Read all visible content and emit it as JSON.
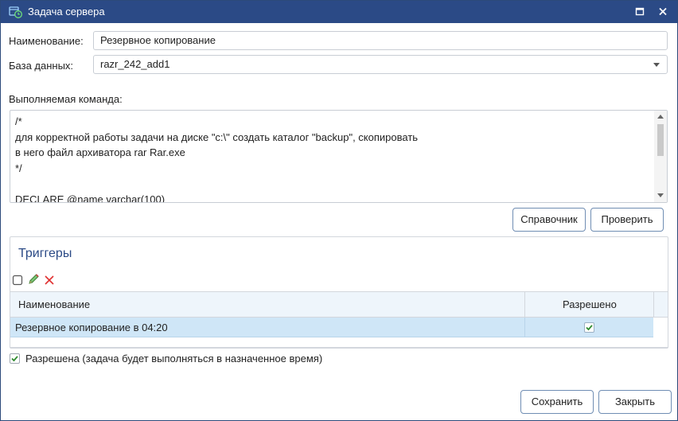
{
  "window": {
    "title": "Задача сервера"
  },
  "form": {
    "name_label": "Наименование:",
    "name_value": "Резервное копирование",
    "database_label": "База данных:",
    "database_value": "razr_242_add1",
    "command_label": "Выполняемая команда:",
    "command_text": "/*\nдля корректной работы задачи на диске \"c:\\\" создать каталог \"backup\", скопировать\nв него файл архиватора rar Rar.exe\n*/\n\nDECLARE @name varchar(100)"
  },
  "buttons": {
    "reference": "Справочник",
    "check": "Проверить",
    "save": "Сохранить",
    "close": "Закрыть"
  },
  "triggers": {
    "title": "Триггеры",
    "columns": [
      "Наименование",
      "Разрешено"
    ],
    "rows": [
      {
        "name": "Резервное копирование в 04:20",
        "enabled": true
      }
    ]
  },
  "enabled_option": {
    "label": "Разрешена (задача будет выполняться в назначенное время)",
    "checked": true
  },
  "colors": {
    "titlebar": "#2b4a86",
    "accent": "#2b4a86",
    "selected_row": "#cfe6f7",
    "check_green": "#2e8b2e",
    "delete_red": "#e03030"
  }
}
